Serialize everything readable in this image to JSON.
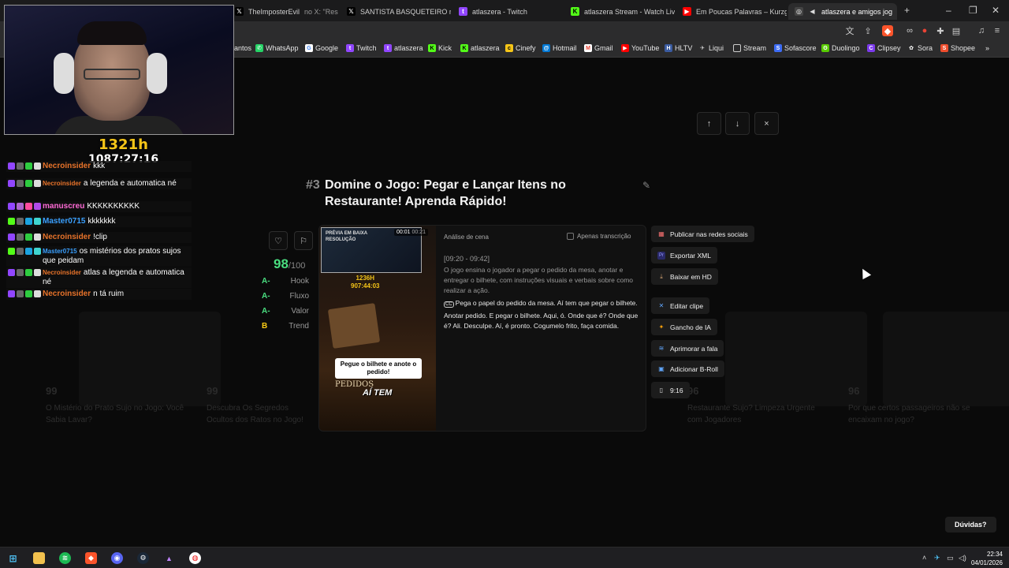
{
  "browser": {
    "tabs": [
      {
        "title": "TheImposterEvil",
        "suffix": "no X: \"Res",
        "icon": "x-icon",
        "color": "#000000",
        "active": false
      },
      {
        "title": "SANTISTA BASQUETEIRO no X:",
        "icon": "x-icon",
        "color": "#000000",
        "active": false
      },
      {
        "title": "atlaszera - Twitch",
        "icon": "twitch-icon",
        "color": "#9146ff",
        "active": false
      },
      {
        "title": "atlaszera Stream - Watch Live o",
        "icon": "kick-icon",
        "color": "#53fc18",
        "active": false
      },
      {
        "title": "Em Poucas Palavras – Kurzgesa",
        "icon": "youtube-icon",
        "color": "#ff0000",
        "active": false
      },
      {
        "title": "atlaszera e amigos jog",
        "icon": "speaker-icon",
        "color": "#444444",
        "active": true
      }
    ],
    "bookmarks": [
      {
        "label": "antos",
        "color": "#2c2c2d"
      },
      {
        "label": "WhatsApp",
        "color": "#25d366"
      },
      {
        "label": "Google",
        "color": "#4285f4"
      },
      {
        "label": "Twitch",
        "color": "#9146ff"
      },
      {
        "label": "atlaszera",
        "color": "#9146ff"
      },
      {
        "label": "Kick",
        "color": "#53fc18"
      },
      {
        "label": "atlaszera",
        "color": "#53fc18"
      },
      {
        "label": "Cinefy",
        "color": "#f5c518"
      },
      {
        "label": "Hotmail",
        "color": "#0078d4"
      },
      {
        "label": "Gmail",
        "color": "#ea4335"
      },
      {
        "label": "YouTube",
        "color": "#ff0000"
      },
      {
        "label": "HLTV",
        "color": "#3a5ba0"
      },
      {
        "label": "Liqui",
        "color": "#888888"
      },
      {
        "label": "Stream",
        "color": "#666666"
      },
      {
        "label": "Sofascore",
        "color": "#3d6cf4"
      },
      {
        "label": "Duolingo",
        "color": "#58cc02"
      },
      {
        "label": "Clipsey",
        "color": "#7c3aed"
      },
      {
        "label": "Sora",
        "color": "#ffffff"
      },
      {
        "label": "Shopee",
        "color": "#ee4d2d"
      }
    ],
    "new_tab": "+"
  },
  "clip": {
    "rank": "#3",
    "title": "Domine o Jogo: Pegar e Lançar Itens no Restaurante! Aprenda Rápido!",
    "score": "98",
    "score_total": "/100",
    "grades": [
      {
        "grade": "A-",
        "label": "Hook",
        "color": "#4ade80"
      },
      {
        "grade": "A-",
        "label": "Fluxo",
        "color": "#4ade80"
      },
      {
        "grade": "A-",
        "label": "Valor",
        "color": "#4ade80"
      },
      {
        "grade": "B",
        "label": "Trend",
        "color": "#facc15"
      }
    ],
    "preview": {
      "badge_line1": "PRÉVIA EM BAIXA",
      "badge_line2": "RESOLUÇÃO",
      "time_current": "00:01",
      "time_total": "00:21",
      "overlay_hours": "1236H",
      "overlay_timer": "907:44:03",
      "caption": "Pegue o bilhete e anote o pedido!",
      "sign": "PEDIDOS",
      "shout": "AÍ TEM"
    },
    "analysis_heading": "Análise de cena",
    "transcript_only_label": "Apenas transcrição",
    "time_range": "[09:20 - 09:42]",
    "description": "O jogo ensina o jogador a pegar o pedido da mesa, anotar e entregar o bilhete, com instruções visuais e verbais sobre como realizar a ação.",
    "transcript_icon": "CC",
    "transcript": "Pega o papel do pedido da mesa. Aí tem que pegar o bilhete. Anotar pedido. E pegar o bilhete. Aqui, ó. Onde que é? Onde que é? Ali. Desculpe. Aí, é pronto. Cogumelo frito, faça comida."
  },
  "actions": [
    {
      "label": "Publicar nas redes sociais",
      "icon": "calendar-icon",
      "glyph": "▦",
      "color": "#f87171"
    },
    {
      "label": "Exportar XML",
      "icon": "premiere-icon",
      "glyph": "Pr",
      "color": "#9999ff"
    },
    {
      "label": "Baixar em HD",
      "icon": "download-icon",
      "glyph": "⤓",
      "color": "#d4a373"
    },
    {
      "label": "Editar clipe",
      "icon": "scissors-icon",
      "glyph": "✕",
      "color": "#60a5fa"
    },
    {
      "label": "Gancho de IA",
      "icon": "hook-icon",
      "glyph": "✦",
      "color": "#f59e0b"
    },
    {
      "label": "Aprimorar a fala",
      "icon": "waveform-icon",
      "glyph": "≋",
      "color": "#60a5fa"
    },
    {
      "label": "Adicionar B-Roll",
      "icon": "image-icon",
      "glyph": "▣",
      "color": "#60a5fa"
    },
    {
      "label": "9:16",
      "icon": "phone-icon",
      "glyph": "▯",
      "color": "#dddddd"
    }
  ],
  "nav": {
    "up": "↑",
    "down": "↓",
    "close": "×"
  },
  "help_button": "Dúvidas?",
  "stream": {
    "hours": "1321h",
    "timer": "1087:27:16",
    "chat": [
      {
        "user": "Necroinsider",
        "text": "kkk",
        "color": "#e8732a",
        "small": false
      },
      {
        "user": "Necroinsider",
        "text": "a legenda e automatica né",
        "color": "#e8732a",
        "small": true
      },
      {
        "user": "manuscreu",
        "text": "KKKKKKKKKK",
        "color": "#ff6bd6",
        "small": false
      },
      {
        "user": "Master0715",
        "text": "kkkkkkk",
        "color": "#3aa0ff",
        "small": false
      },
      {
        "user": "Necroinsider",
        "text": "!clip",
        "color": "#e8732a",
        "small": false
      },
      {
        "user": "Master0715",
        "text": "os mistérios dos pratos sujos que peidam",
        "color": "#3aa0ff",
        "small": true
      },
      {
        "user": "Necroinsider",
        "text": "atlas a legenda e automatica né",
        "color": "#e8732a",
        "small": true
      },
      {
        "user": "Necroinsider",
        "text": "n tá ruim",
        "color": "#e8732a",
        "small": false
      }
    ]
  },
  "background_cards": [
    {
      "num": "99",
      "title": "O Mistério do Prato Sujo no Jogo: Você Sabia Lavar?"
    },
    {
      "num": "99",
      "title": "Descubra Os Segredos Ocultos dos Ratos no Jogo!"
    },
    {
      "num": "96",
      "title": "Restaurante Sujo? Limpeza Urgente com Jogadores"
    },
    {
      "num": "96",
      "title": "Por que certos passageiros não se encaixam no jogo?"
    }
  ],
  "taskbar": {
    "time": "22:34",
    "date": "04/01/2026"
  }
}
